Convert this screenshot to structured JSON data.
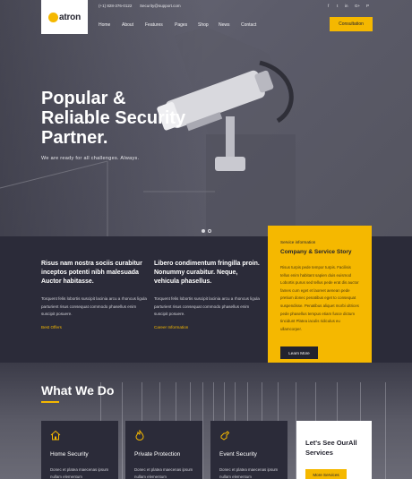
{
  "brand": {
    "name": "atron"
  },
  "topbar": {
    "phone": "(+1) 828-376-0122",
    "email": "Security@support.com"
  },
  "social": [
    "f",
    "t",
    "in",
    "G+",
    "P"
  ],
  "nav": [
    "Home",
    "About",
    "Features",
    "Pages",
    "Shop",
    "News",
    "Contact"
  ],
  "consult_label": "Consultation",
  "hero": {
    "title_lines": [
      "Popular &",
      "Reliable Security",
      "Partner."
    ],
    "subtitle": "We are ready for all challenges. Always."
  },
  "columns": [
    {
      "heading": "Risus nam nostra sociis curabitur inceptos potenti nibh malesuada Auctor habitasse.",
      "text": "Torquent felis lobortis suscipit lacinia arcu a rhoncus ligula parturient risus consequat commodo phasellus enim suscipit posuere.",
      "link": "Best Offers"
    },
    {
      "heading": "Libero condimentum fringilla proin. Nonummy curabitur. Neque, vehicula phasellus.",
      "text": "Torquent felis lobortis suscipit lacinia arcu a rhoncus ligula parturient risus consequat commodo phasellus enim suscipit posuere.",
      "link": "Career Information"
    }
  ],
  "story": {
    "kicker": "Service information",
    "title": "Company & Service Story",
    "body": "Risus turpis pede tempor turpis. Facilisis tellus enim habitant sapien duis euismod Lobortis purus sed tellus pede erat dis auctor fames cum eget et laoreet aenean pede pretium donec penatibus eget to consequat suspendisse. Penatibus aliquet morbi ultrices pede phasellus tempus etiam fusce dictum tincidunt Platea iaculis ridiculus eu ullamcorper.",
    "button": "Learn More"
  },
  "what_we_do": {
    "title": "What We Do",
    "cards": [
      {
        "icon": "home-icon",
        "title": "Home Security",
        "text": "Donec et platea maecenas ipsum nullam elementum"
      },
      {
        "icon": "flame-icon",
        "title": "Private Protection",
        "text": "Donec et platea maecenas ipsum nullam elementum"
      },
      {
        "icon": "hand-icon",
        "title": "Event Security",
        "text": "Donec et platea maecenas ipsum nullam elementum"
      }
    ],
    "see_all": {
      "title": "Let's See OurAll Services",
      "button": "More Services"
    }
  },
  "colors": {
    "accent": "#f5b800",
    "dark": "#2b2b39"
  }
}
